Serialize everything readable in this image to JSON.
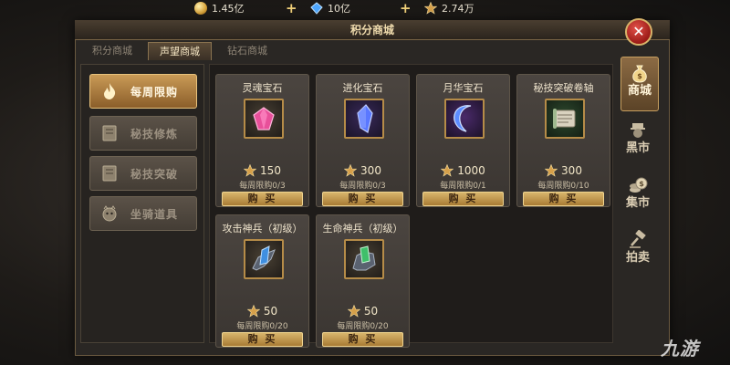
{
  "currency": {
    "gold": "1.45亿",
    "diamond": "10亿",
    "points": "2.74万",
    "add_symbol": "+"
  },
  "window": {
    "title": "积分商城",
    "close_symbol": "✕"
  },
  "tabs": [
    {
      "label": "积分商城",
      "active": false
    },
    {
      "label": "声望商城",
      "active": true
    },
    {
      "label": "钻石商城",
      "active": false
    }
  ],
  "left_menu": [
    {
      "label": "每周限购",
      "icon": "flame-icon",
      "active": true
    },
    {
      "label": "秘技修炼",
      "icon": "book-icon",
      "active": false
    },
    {
      "label": "秘技突破",
      "icon": "book-icon",
      "active": false
    },
    {
      "label": "坐骑道具",
      "icon": "mount-icon",
      "active": false
    }
  ],
  "items": [
    {
      "name": "灵魂宝石",
      "price": "150",
      "limit": "每周限购0/3",
      "buy": "购 买",
      "icon": "pink-gem-icon",
      "color": "#e8509a"
    },
    {
      "name": "进化宝石",
      "price": "300",
      "limit": "每周限购0/3",
      "buy": "购 买",
      "icon": "blue-crystal-icon",
      "color": "#5a78ff"
    },
    {
      "name": "月华宝石",
      "price": "1000",
      "limit": "每周限购0/1",
      "buy": "购 买",
      "icon": "crescent-gem-icon",
      "color": "#5d8cff"
    },
    {
      "name": "秘技突破卷轴",
      "price": "300",
      "limit": "每周限购0/10",
      "buy": "购 买",
      "icon": "scroll-icon",
      "color": "#9fb98e"
    },
    {
      "name": "攻击神兵（初级）",
      "price": "50",
      "limit": "每周限购0/20",
      "buy": "购 买",
      "icon": "blue-weapon-icon",
      "color": "#3f8fe0"
    },
    {
      "name": "生命神兵（初级）",
      "price": "50",
      "limit": "每周限购0/20",
      "buy": "购 买",
      "icon": "green-weapon-icon",
      "color": "#3fbf6a"
    }
  ],
  "side_tabs": [
    {
      "label": "商城",
      "icon": "money-bag-icon",
      "active": true
    },
    {
      "label": "黑市",
      "icon": "merchant-icon",
      "active": false
    },
    {
      "label": "集市",
      "icon": "coins-icon",
      "active": false
    },
    {
      "label": "拍卖",
      "icon": "gavel-icon",
      "active": false
    }
  ],
  "watermark": "九游",
  "colors": {
    "accent_gold": "#d8b56c",
    "close_red": "#c0302a",
    "panel_dark": "#2a2724"
  }
}
